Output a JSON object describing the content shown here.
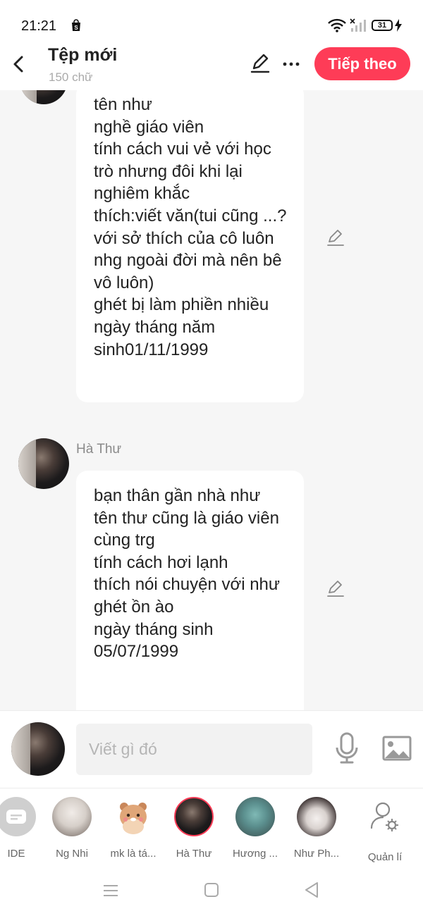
{
  "status": {
    "time": "21:21",
    "battery": "31"
  },
  "header": {
    "title": "Tệp mới",
    "subtitle": "150 chữ",
    "next_label": "Tiếp theo"
  },
  "messages": [
    {
      "sender": "",
      "text": "tên như\nnghề giáo viên\ntính cách vui vẻ với học trò nhưng đôi khi lại nghiêm khắc\nthích:viết văn(tui cũng ...? với sở thích của cô luôn nhg ngoài đời mà nên bê vô luôn)\nghét bị làm phiền nhiều\n ngày tháng năm sinh01/11/1999"
    },
    {
      "sender": "Hà Thư",
      "text": "bạn thân gần nhà như\ntên thư cũng là giáo viên cùng trg\ntính cách hơi lạnh\nthích nói chuyện với như\nghét ồn ào\nngày tháng sinh\n05/07/1999"
    }
  ],
  "composer": {
    "placeholder": "Viết gì đó"
  },
  "characters": [
    {
      "name": "IDE",
      "selected": false
    },
    {
      "name": "Ng Nhi",
      "selected": false
    },
    {
      "name": "mk là tá...",
      "selected": false
    },
    {
      "name": "Hà Thư",
      "selected": true
    },
    {
      "name": "Hương ...",
      "selected": false
    },
    {
      "name": "Như Ph...",
      "selected": false
    },
    {
      "name": "Quản lí",
      "selected": false
    }
  ],
  "colors": {
    "accent": "#fe3c57",
    "background": "#f6f6f6"
  }
}
